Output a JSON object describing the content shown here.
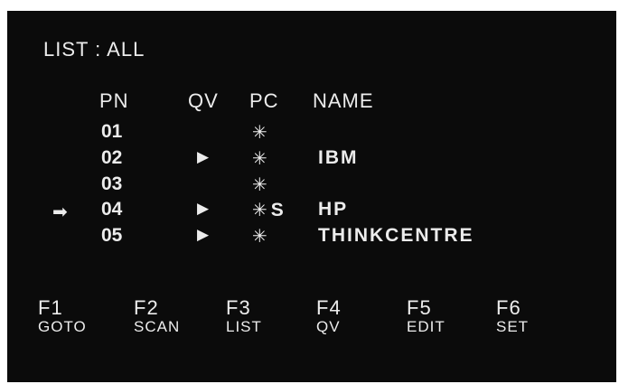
{
  "title": "LIST : ALL",
  "headers": {
    "pn": "PN",
    "qv": "QV",
    "pc": "PC",
    "name": "NAME"
  },
  "selection_arrow": "➡",
  "rows": [
    {
      "pn": "01",
      "qv": "",
      "pc": "✳",
      "pc_extra": "",
      "name": ""
    },
    {
      "pn": "02",
      "qv": "▶",
      "pc": "✳",
      "pc_extra": "",
      "name": "IBM"
    },
    {
      "pn": "03",
      "qv": "",
      "pc": "✳",
      "pc_extra": "",
      "name": ""
    },
    {
      "pn": "04",
      "qv": "▶",
      "pc": "✳",
      "pc_extra": "S",
      "name": "HP"
    },
    {
      "pn": "05",
      "qv": "▶",
      "pc": "✳",
      "pc_extra": "",
      "name": "THINKCENTRE"
    }
  ],
  "fkeys": [
    {
      "key": "F1",
      "action": "GOTO"
    },
    {
      "key": "F2",
      "action": "SCAN"
    },
    {
      "key": "F3",
      "action": "LIST"
    },
    {
      "key": "F4",
      "action": "QV"
    },
    {
      "key": "F5",
      "action": "EDIT"
    },
    {
      "key": "F6",
      "action": "SET"
    }
  ]
}
